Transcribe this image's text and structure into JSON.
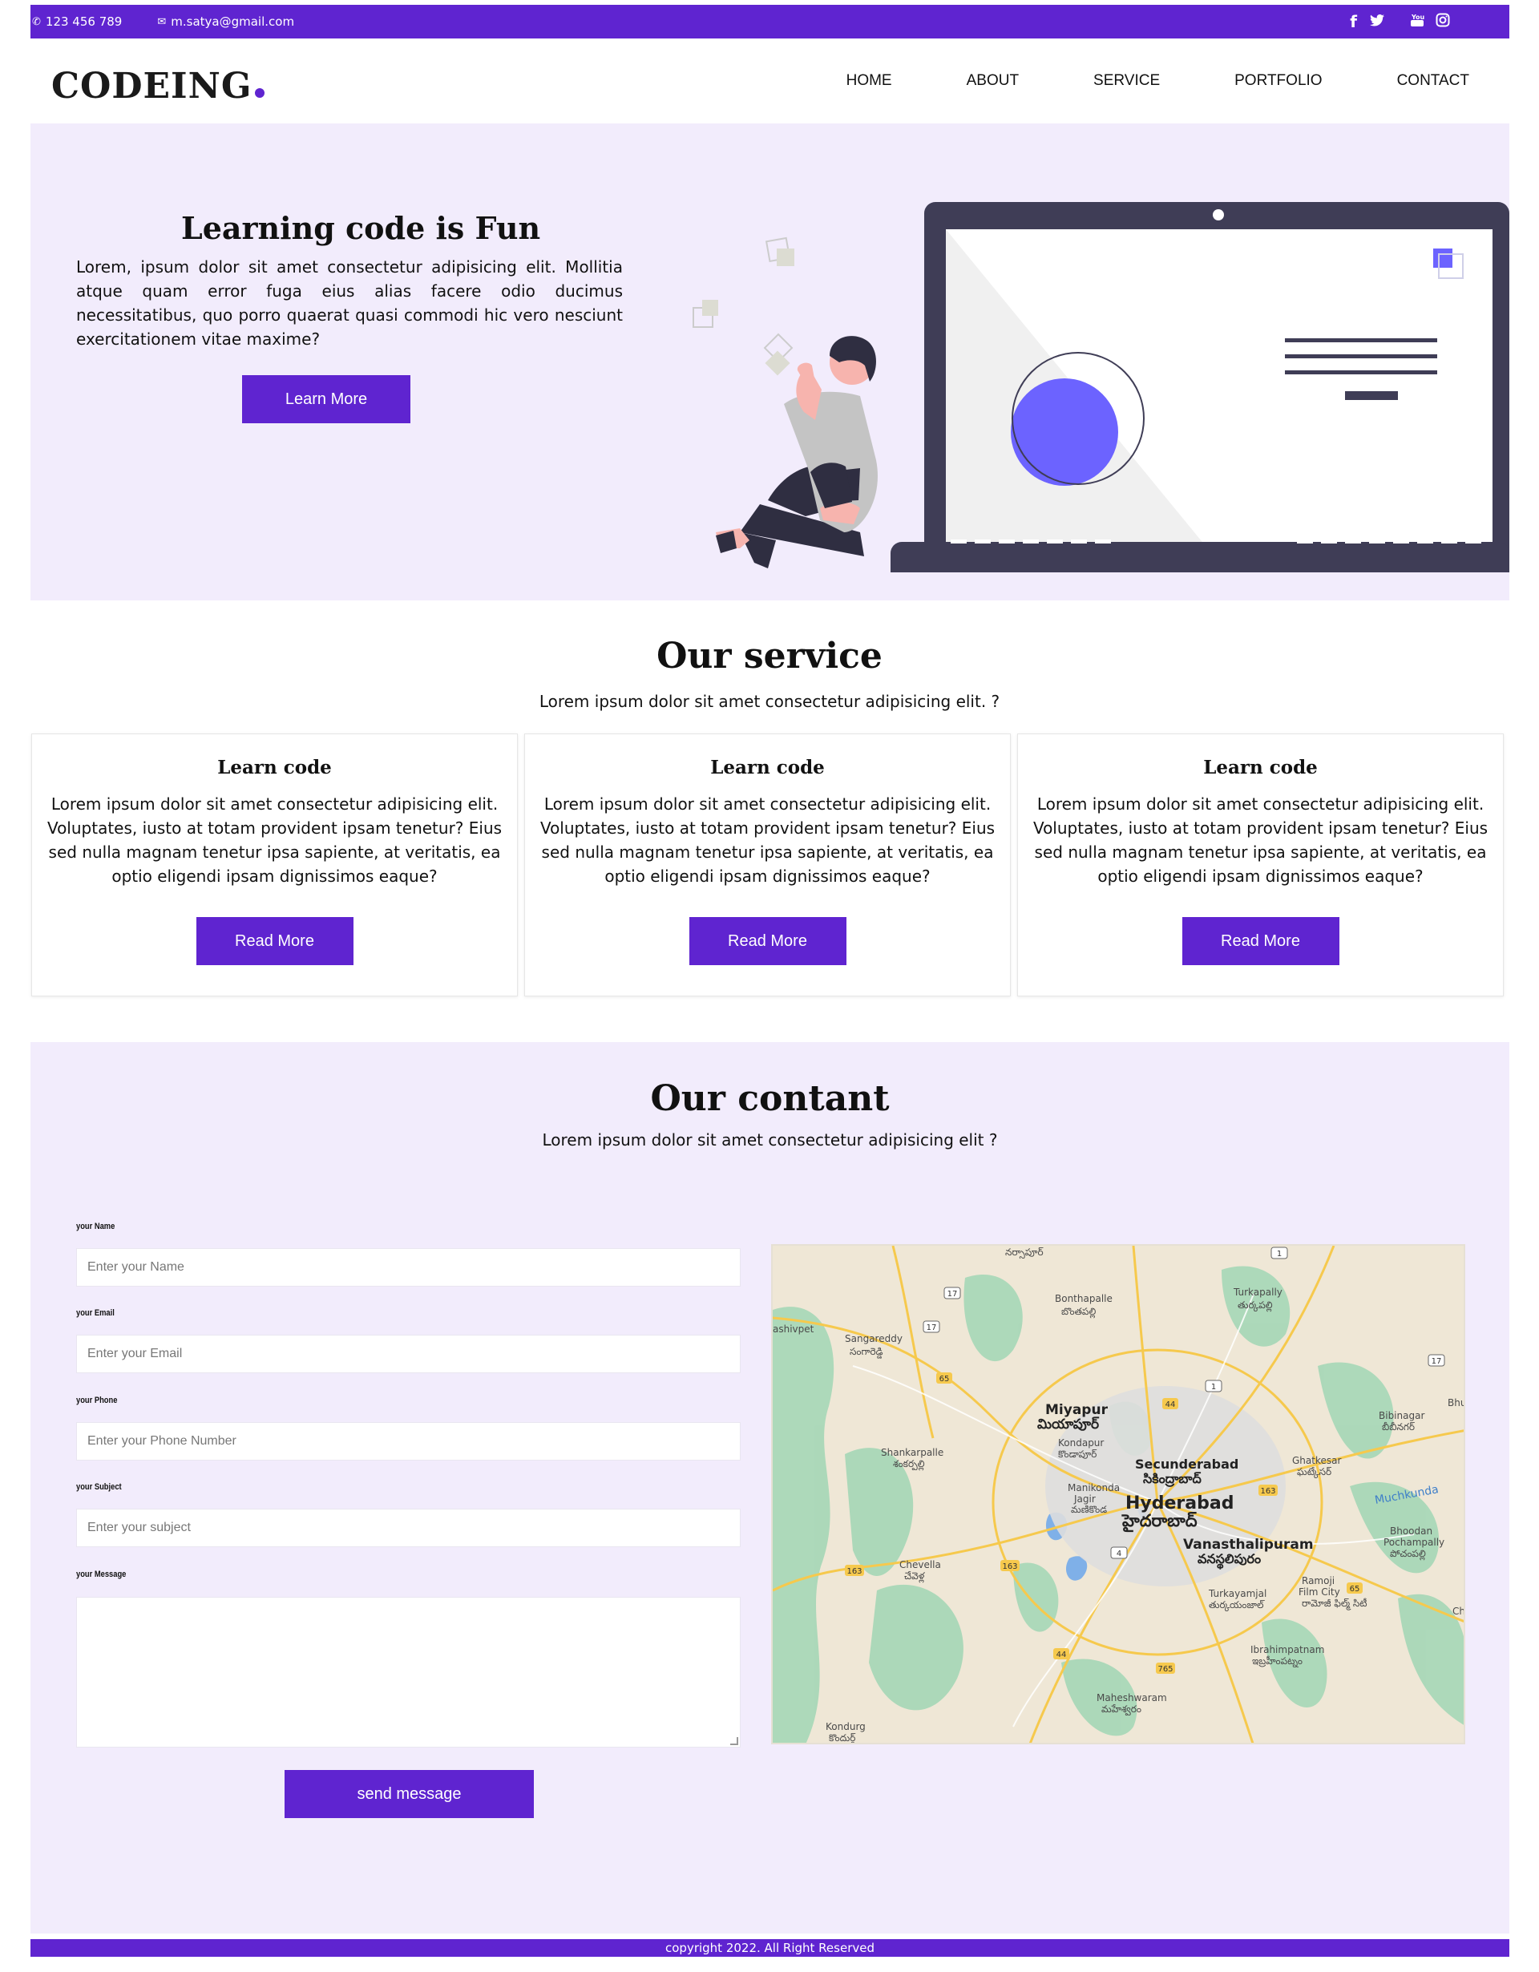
{
  "topbar": {
    "phone": "123 456 789",
    "email": "m.satya@gmail.com",
    "social": [
      "facebook-icon",
      "twitter-icon",
      "youtube-icon",
      "instagram-icon"
    ]
  },
  "brand": {
    "logo": "CODEING",
    "accent": "#5f24d0"
  },
  "nav": [
    "HOME",
    "ABOUT",
    "SERVICE",
    "PORTFOLIO",
    "CONTACT"
  ],
  "hero": {
    "title": "Learning code is Fun",
    "text": "Lorem, ipsum dolor sit amet consectetur adipisicing elit. Mollitia atque quam error fuga eius alias facere odio ducimus necessitatibus, quo porro quaerat quasi commodi hic vero nesciunt exercitationem vitae maxime?",
    "button": "Learn More"
  },
  "service": {
    "title": "Our service",
    "subtitle": "Lorem ipsum dolor sit amet consectetur adipisicing elit. ?",
    "cards": [
      {
        "title": "Learn code",
        "text": "Lorem ipsum dolor sit amet consectetur adipisicing elit. Voluptates, iusto at totam provident ipsam tenetur? Eius sed nulla magnam tenetur ipsa sapiente, at veritatis, ea optio eligendi ipsam dignissimos eaque?",
        "button": "Read More"
      },
      {
        "title": "Learn code",
        "text": "Lorem ipsum dolor sit amet consectetur adipisicing elit. Voluptates, iusto at totam provident ipsam tenetur? Eius sed nulla magnam tenetur ipsa sapiente, at veritatis, ea optio eligendi ipsam dignissimos eaque?",
        "button": "Read More"
      },
      {
        "title": "Learn code",
        "text": "Lorem ipsum dolor sit amet consectetur adipisicing elit. Voluptates, iusto at totam provident ipsam tenetur? Eius sed nulla magnam tenetur ipsa sapiente, at veritatis, ea optio eligendi ipsam dignissimos eaque?",
        "button": "Read More"
      }
    ]
  },
  "contact": {
    "title": "Our contant",
    "subtitle": "Lorem ipsum dolor sit amet consectetur adipisicing elit ?",
    "fields": [
      {
        "label": "your Name",
        "placeholder": "Enter your Name"
      },
      {
        "label": "your Email",
        "placeholder": "Enter your Email"
      },
      {
        "label": "your Phone",
        "placeholder": "Enter your Phone Number"
      },
      {
        "label": "your Subject",
        "placeholder": "Enter your subject"
      }
    ],
    "message_label": "your Message",
    "send_button": "send message"
  },
  "map": {
    "places": [
      {
        "name": "Bonthapalle",
        "local": "బొంతపల్లి"
      },
      {
        "name": "Turkapally",
        "local": "తుర్కపల్లి"
      },
      {
        "name": "Sangareddy",
        "local": "సంగారెడ్డి"
      },
      {
        "name": "Miyapur",
        "local": "మియాపూర్"
      },
      {
        "name": "Kondapur",
        "local": "కొండాపూర్"
      },
      {
        "name": "Shankarpalle",
        "local": "శంకర్పల్లి"
      },
      {
        "name": "Secunderabad",
        "local": "సికింద్రాబాద్"
      },
      {
        "name": "Manikonda",
        "local": ""
      },
      {
        "name": "Jagir",
        "local": "మణికొండ"
      },
      {
        "name": "Hyderabad",
        "local": "హైదరాబాద్"
      },
      {
        "name": "Ghatkesar",
        "local": "ఘట్కేసర్"
      },
      {
        "name": "Bibinagar",
        "local": "బీబీనగర్"
      },
      {
        "name": "Vanasthalipuram",
        "local": "వనస్థలిపురం"
      },
      {
        "name": "Chevella",
        "local": "చేవెళ్ల"
      },
      {
        "name": "Turkayamjal",
        "local": "తుర్కయంజాల్"
      },
      {
        "name": "Ramoji",
        "local": ""
      },
      {
        "name": "Film City",
        "local": "రామోజీ ఫిల్మ్ సిటీ"
      },
      {
        "name": "Bhoodan",
        "local": ""
      },
      {
        "name": "Pochampally",
        "local": "పోచంపల్లి"
      },
      {
        "name": "Ibrahimpatnam",
        "local": "ఇబ్రహీంపట్నం"
      },
      {
        "name": "Maheshwaram",
        "local": "మహేశ్వరం"
      },
      {
        "name": "Kondurg",
        "local": "కొందుర్గ్"
      },
      {
        "name": "Muchkunda",
        "local": ""
      },
      {
        "name": "ashivpet",
        "local": ""
      },
      {
        "name": "Bhuva",
        "local": ""
      },
      {
        "name": "Chc",
        "local": ""
      }
    ],
    "route_shields": [
      "17",
      "17",
      "65",
      "44",
      "163",
      "163",
      "163",
      "4",
      "44",
      "765",
      "65",
      "1",
      "1",
      "17"
    ],
    "top_label": "నర్సాపూర్"
  },
  "footer": {
    "text": "copyright 2022. All Right Reserved"
  }
}
